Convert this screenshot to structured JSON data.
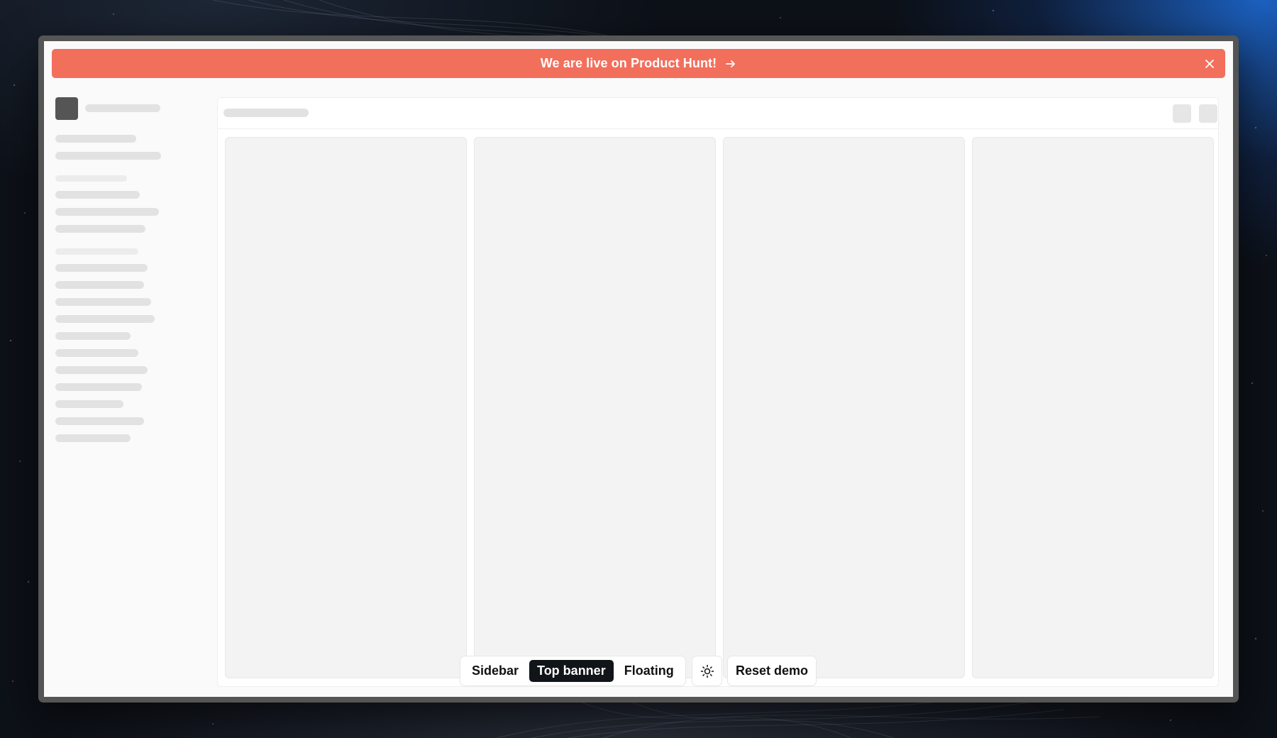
{
  "banner": {
    "text": "We are live on Product Hunt!",
    "color": "#f26f5c",
    "arrow_icon": "arrow-right-icon",
    "close_icon": "close-icon"
  },
  "toolbar": {
    "segments": [
      {
        "label": "Sidebar",
        "active": false
      },
      {
        "label": "Top banner",
        "active": true
      },
      {
        "label": "Floating",
        "active": false
      }
    ],
    "theme_icon": "sun-icon",
    "reset_label": "Reset demo"
  },
  "colors": {
    "active_segment": "#111418",
    "window_frame": "#555555",
    "column_bg": "#f3f3f3"
  }
}
